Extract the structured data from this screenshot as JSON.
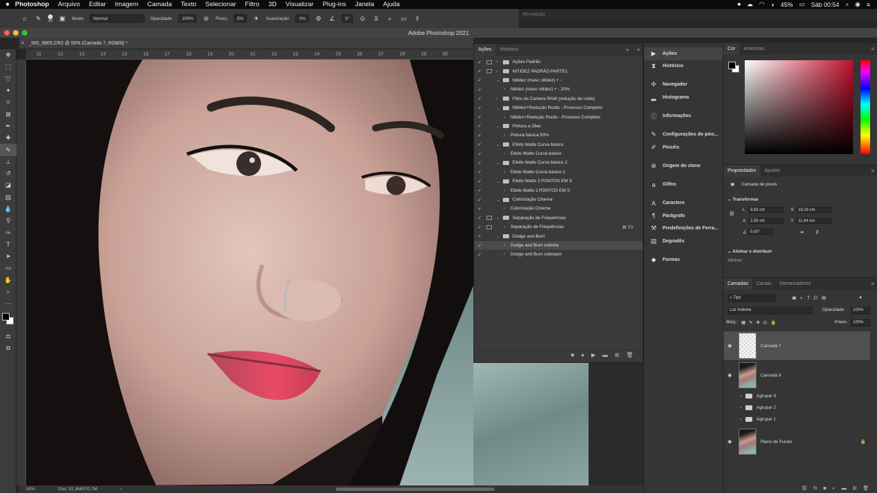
{
  "menubar": {
    "items": [
      "Photoshop",
      "Arquivo",
      "Editar",
      "Imagem",
      "Camada",
      "Texto",
      "Selecionar",
      "Filtro",
      "3D",
      "Visualizar",
      "Plug-ins",
      "Janela",
      "Ajuda"
    ],
    "battery": "45%",
    "clock": "Sáb 00:54"
  },
  "options": {
    "brush_size": "50",
    "mode_label": "Modo:",
    "mode_value": "Normal",
    "opacity_label": "Opacidade:",
    "opacity_value": "100%",
    "flow_label": "Fluxo:",
    "flow_value": "3%",
    "smoothing_label": "Suavização:",
    "smoothing_value": "0%",
    "angle_value": "0°",
    "revelacao": "Revelação"
  },
  "window": {
    "title": "Adobe Photoshop 2021",
    "doc_tab": "_MG_9805.CR2 @ 50% (Camada 7, RGB/8) *"
  },
  "ruler": {
    "ticks": [
      "11",
      "12",
      "13",
      "14",
      "15",
      "16",
      "17",
      "18",
      "19",
      "20",
      "21",
      "22",
      "23",
      "24",
      "25",
      "26",
      "27",
      "28",
      "29",
      "30"
    ]
  },
  "status": {
    "zoom": "50%",
    "doc": "Doc: 51,3M/570,7M"
  },
  "actions_panel": {
    "tabs": [
      "Ações",
      "Histórico"
    ],
    "rows": [
      {
        "label": "Ações Padrão",
        "level": 0,
        "dialog": true,
        "folder": true,
        "open": false,
        "selected": false,
        "shortcut": ""
      },
      {
        "label": "NITIDEZ PADRÃO PARTE1",
        "level": 0,
        "dialog": true,
        "folder": true,
        "open": false,
        "selected": false,
        "shortcut": ""
      },
      {
        "label": "Nitidez (masc nitidez) + -",
        "level": 0,
        "dialog": false,
        "folder": true,
        "open": true,
        "selected": false,
        "shortcut": ""
      },
      {
        "label": "Nitidez (masc nitidez) + - 20%",
        "level": 1,
        "dialog": false,
        "folder": false,
        "open": false,
        "selected": false,
        "shortcut": ""
      },
      {
        "label": "Filtro do Camera RAW (redução de ruído)",
        "level": 0,
        "dialog": false,
        "folder": true,
        "open": false,
        "selected": false,
        "shortcut": ""
      },
      {
        "label": "Nitidez+Redução Ruído - Processo Completo",
        "level": 0,
        "dialog": false,
        "folder": true,
        "open": true,
        "selected": false,
        "shortcut": ""
      },
      {
        "label": "Nitidez+Redução Ruído - Processo Completo",
        "level": 1,
        "dialog": false,
        "folder": false,
        "open": false,
        "selected": false,
        "shortcut": ""
      },
      {
        "label": "Pintura a Óleo",
        "level": 0,
        "dialog": false,
        "folder": true,
        "open": true,
        "selected": false,
        "shortcut": ""
      },
      {
        "label": "Pintura básica 50%",
        "level": 1,
        "dialog": false,
        "folder": false,
        "open": false,
        "selected": false,
        "shortcut": ""
      },
      {
        "label": "Efeito Matte Curva básico",
        "level": 0,
        "dialog": false,
        "folder": true,
        "open": true,
        "selected": false,
        "shortcut": ""
      },
      {
        "label": "Efeito Matte Curva básico",
        "level": 1,
        "dialog": false,
        "folder": false,
        "open": false,
        "selected": false,
        "shortcut": ""
      },
      {
        "label": "Efeito Matte Curva básico 2",
        "level": 0,
        "dialog": false,
        "folder": true,
        "open": true,
        "selected": false,
        "shortcut": ""
      },
      {
        "label": "Efeito Matte Curva básico 2",
        "level": 1,
        "dialog": false,
        "folder": false,
        "open": false,
        "selected": false,
        "shortcut": ""
      },
      {
        "label": "Efeito Matte 2 PONTOS EM S",
        "level": 0,
        "dialog": false,
        "folder": true,
        "open": true,
        "selected": false,
        "shortcut": ""
      },
      {
        "label": "Efeito Matte 2 PONTOS EM S",
        "level": 1,
        "dialog": false,
        "folder": false,
        "open": false,
        "selected": false,
        "shortcut": ""
      },
      {
        "label": "Colorização Cinema",
        "level": 0,
        "dialog": false,
        "folder": true,
        "open": true,
        "selected": false,
        "shortcut": ""
      },
      {
        "label": "Colorização Cinema",
        "level": 1,
        "dialog": false,
        "folder": false,
        "open": false,
        "selected": false,
        "shortcut": ""
      },
      {
        "label": "Separação de Frequências",
        "level": 0,
        "dialog": true,
        "folder": true,
        "open": true,
        "selected": false,
        "shortcut": ""
      },
      {
        "label": "Separação de Frequências",
        "level": 1,
        "dialog": true,
        "folder": false,
        "open": false,
        "selected": false,
        "shortcut": "⌘ F3"
      },
      {
        "label": "Dodge and Burn",
        "level": 0,
        "dialog": false,
        "folder": true,
        "open": true,
        "selected": false,
        "shortcut": ""
      },
      {
        "label": "Dodge and Burn indireta",
        "level": 1,
        "dialog": false,
        "folder": false,
        "open": false,
        "selected": true,
        "shortcut": ""
      },
      {
        "label": "Dodge and Burn sobrepor",
        "level": 1,
        "dialog": false,
        "folder": false,
        "open": false,
        "selected": false,
        "shortcut": ""
      }
    ]
  },
  "dock": {
    "groups": [
      [
        {
          "icon": "play-icon",
          "label": "Ações"
        },
        {
          "icon": "history-icon",
          "label": "Histórico"
        }
      ],
      [
        {
          "icon": "navigator-icon",
          "label": "Navegador"
        },
        {
          "icon": "histogram-icon",
          "label": "Histograma"
        }
      ],
      [
        {
          "icon": "info-icon",
          "label": "Informações"
        }
      ],
      [
        {
          "icon": "brush-settings-icon",
          "label": "Configurações do pinc..."
        },
        {
          "icon": "brushes-icon",
          "label": "Pincéis"
        }
      ],
      [
        {
          "icon": "clone-source-icon",
          "label": "Origem do clone"
        }
      ],
      [
        {
          "icon": "glyphs-icon",
          "label": "Glifos"
        }
      ],
      [
        {
          "icon": "character-icon",
          "label": "Caractere"
        },
        {
          "icon": "paragraph-icon",
          "label": "Parágrafo"
        },
        {
          "icon": "tool-presets-icon",
          "label": "Predefinições de Ferra..."
        },
        {
          "icon": "gradients-icon",
          "label": "Degradês"
        }
      ],
      [
        {
          "icon": "shapes-icon",
          "label": "Formas"
        }
      ]
    ]
  },
  "color_panel": {
    "tabs": [
      "Cor",
      "Amostras"
    ],
    "foreground": "#000000",
    "background": "#ffffff",
    "hue_color": "#c2102c"
  },
  "properties": {
    "tabs": [
      "Propriedades",
      "Ajustes"
    ],
    "kind": "Camada de pixels",
    "transform_label": "Transformar",
    "L": "9,83 cm",
    "X": "19,16 cm",
    "A": "2,56 cm",
    "Y": "11,84 cm",
    "angle": "0,00°",
    "align_label": "Alinhar e distribuir",
    "align_sub": "Alinhar:"
  },
  "layers_panel": {
    "tabs": [
      "Camadas",
      "Canais",
      "Demarcadores"
    ],
    "filter": "Tipo",
    "blend": "Luz Indireta",
    "opacity_label": "Opacidade:",
    "opacity": "100%",
    "lock_label": "Bloq.:",
    "fill_label": "Preen.:",
    "fill": "100%",
    "layers": [
      {
        "name": "Camada 7",
        "type": "pixel",
        "visible": true,
        "selected": true
      },
      {
        "name": "Camada 6",
        "type": "photo",
        "visible": true,
        "selected": false
      },
      {
        "name": "Agrupar 3",
        "type": "group",
        "visible": false,
        "selected": false
      },
      {
        "name": "Agrupar 2",
        "type": "group",
        "visible": false,
        "selected": false
      },
      {
        "name": "Agrupar 1",
        "type": "group",
        "visible": false,
        "selected": false
      },
      {
        "name": "Plano de Fundo",
        "type": "background",
        "visible": true,
        "selected": false
      }
    ]
  }
}
